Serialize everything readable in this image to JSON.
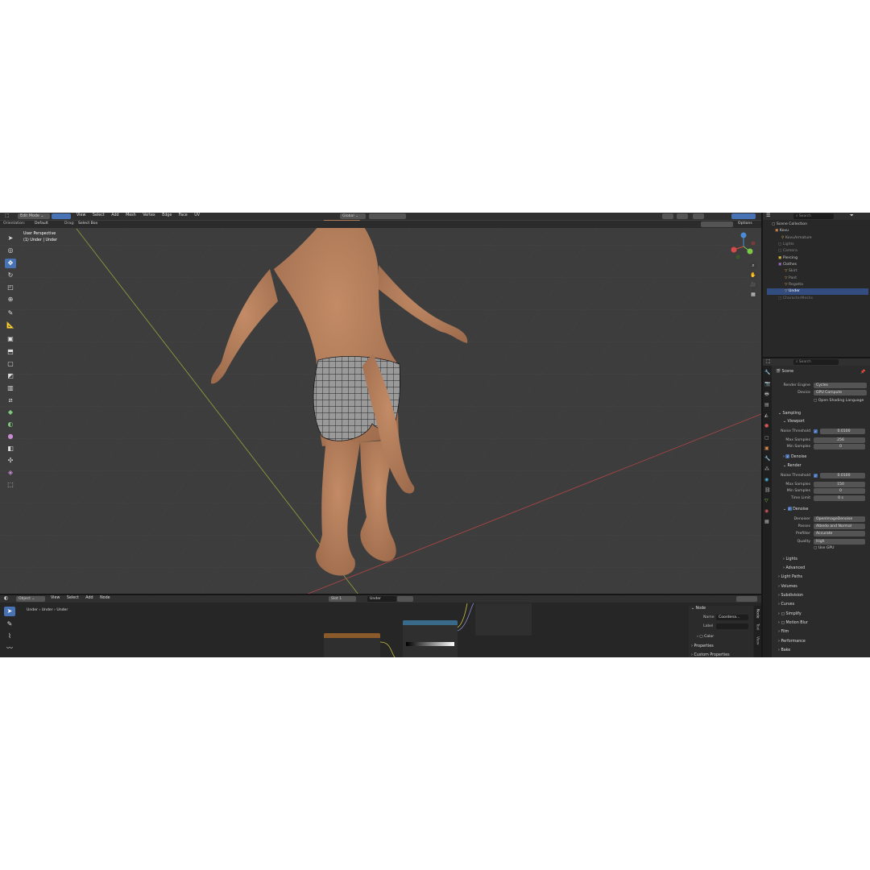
{
  "header": {
    "mode": "Edit Mode",
    "menus": [
      "View",
      "Select",
      "Add",
      "Mesh",
      "Vertex",
      "Edge",
      "Face",
      "UV"
    ],
    "transform_orientation": "Global"
  },
  "tool_settings": {
    "orientation_label": "Orientation:",
    "orientation_value": "Default",
    "drag_label": "Drag:",
    "drag_value": "Select Box",
    "options": "Options"
  },
  "viewport": {
    "title": "User Perspective",
    "object_label": "(1) Under | Under"
  },
  "outliner": {
    "search_placeholder": "Search",
    "root": "Scene Collection",
    "items": [
      "Kovu",
      "KovuArmature",
      "Lights",
      "Camera",
      "Piercing",
      "Clothes",
      "Skirt",
      "Pant",
      "Regatta",
      "Under",
      "CharacterMeshs"
    ]
  },
  "properties": {
    "search_placeholder": "Search",
    "scene_label": "Scene",
    "render_engine_label": "Render Engine",
    "render_engine": "Cycles",
    "device_label": "Device",
    "device": "GPU Compute",
    "osl": "Open Shading Language",
    "sampling": "Sampling",
    "viewport": "Viewport",
    "noise_threshold_label": "Noise Threshold",
    "viewport_noise": "0.0100",
    "max_samples_label": "Max Samples",
    "viewport_max": "256",
    "min_samples_label": "Min Samples",
    "viewport_min": "0",
    "denoise": "Denoise",
    "render": "Render",
    "render_noise": "0.0100",
    "render_max": "150",
    "render_min": "0",
    "time_limit_label": "Time Limit",
    "time_limit": "0 s",
    "denoiser_label": "Denoiser",
    "denoiser": "OpenImageDenoise",
    "passes_label": "Passes",
    "passes": "Albedo and Normal",
    "prefilter_label": "Prefilter",
    "prefilter": "Accurate",
    "quality_label": "Quality",
    "quality": "High",
    "use_gpu": "Use GPU",
    "lights": "Lights",
    "advanced": "Advanced",
    "light_paths": "Light Paths",
    "volumes": "Volumes",
    "subdivision": "Subdivision",
    "curves": "Curves",
    "simplify": "Simplify",
    "motion_blur": "Motion Blur",
    "film": "Film",
    "performance": "Performance",
    "bake": "Bake"
  },
  "node_editor": {
    "editor_type": "Object",
    "menus": [
      "View",
      "Select",
      "Add",
      "Node"
    ],
    "slot": "Slot 1",
    "material": "Under",
    "breadcrumb": [
      "Under",
      "Under",
      "Under"
    ],
    "node_panel": {
      "title": "Node",
      "name_label": "Name",
      "name_value": "Coordena...",
      "label_label": "Label",
      "color": "Color",
      "properties": "Properties",
      "custom_properties": "Custom Properties"
    },
    "tabs": [
      "Node",
      "Tool",
      "View"
    ]
  },
  "colors": {
    "accent": "#4772b3",
    "bg_dark": "#1d1d1d",
    "header": "#303030",
    "viewport": "#3d3d3d",
    "skin": "#b07a58"
  }
}
